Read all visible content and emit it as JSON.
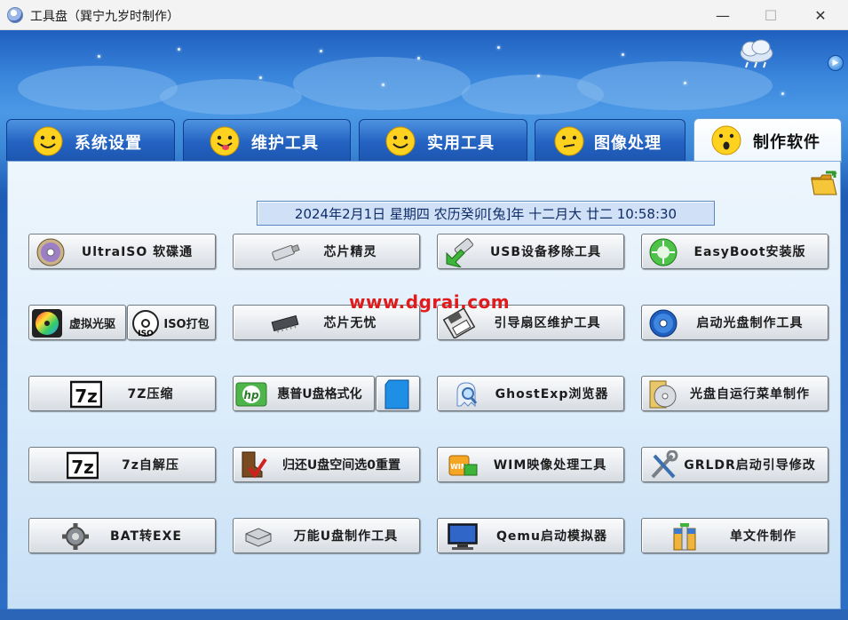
{
  "window": {
    "title": "工具盘（巽宁九岁时制作）",
    "minimize": "—",
    "maximize": "☐",
    "close": "✕"
  },
  "tabs": [
    {
      "label": "系统设置",
      "icon": "smile-face-icon",
      "active": false
    },
    {
      "label": "维护工具",
      "icon": "tongue-face-icon",
      "active": false
    },
    {
      "label": "实用工具",
      "icon": "smile-face-icon",
      "active": false
    },
    {
      "label": "图像处理",
      "icon": "confused-face-icon",
      "active": false
    },
    {
      "label": "制作软件",
      "icon": "surprised-face-icon",
      "active": true
    }
  ],
  "datetime": "2024年2月1日 星期四 农历癸卯[兔]年 十二月大 廿二 10:58:30",
  "watermark": "www.dgrai.com",
  "buttons": {
    "ultraiso": "UltraISO 软碟通",
    "virtual_cd": "虚拟光驱",
    "iso_pack": "ISO打包",
    "sevenz_compress": "7Z压缩",
    "sevenz_sfx": "7z自解压",
    "bat_exe": "BAT转EXE",
    "chip_genius": "芯片精灵",
    "chip_wuyou": "芯片无忧",
    "hp_format": "惠普U盘格式化",
    "restore_space": "归还U盘空间选0重置",
    "universal_usb": "万能U盘制作工具",
    "usb_remove": "USB设备移除工具",
    "boot_sector": "引导扇区维护工具",
    "ghostexp": "GhostExp浏览器",
    "wim_tool": "WIM映像处理工具",
    "qemu": "Qemu启动模拟器",
    "easyboot": "EasyBoot安装版",
    "boot_cd": "启动光盘制作工具",
    "autorun": "光盘自运行菜单制作",
    "grldr": "GRLDR启动引导修改",
    "single_file": "单文件制作"
  },
  "colors": {
    "accent_blue": "#2463c2",
    "watermark_red": "#e01b1b",
    "datetime_text": "#0f2c66"
  }
}
